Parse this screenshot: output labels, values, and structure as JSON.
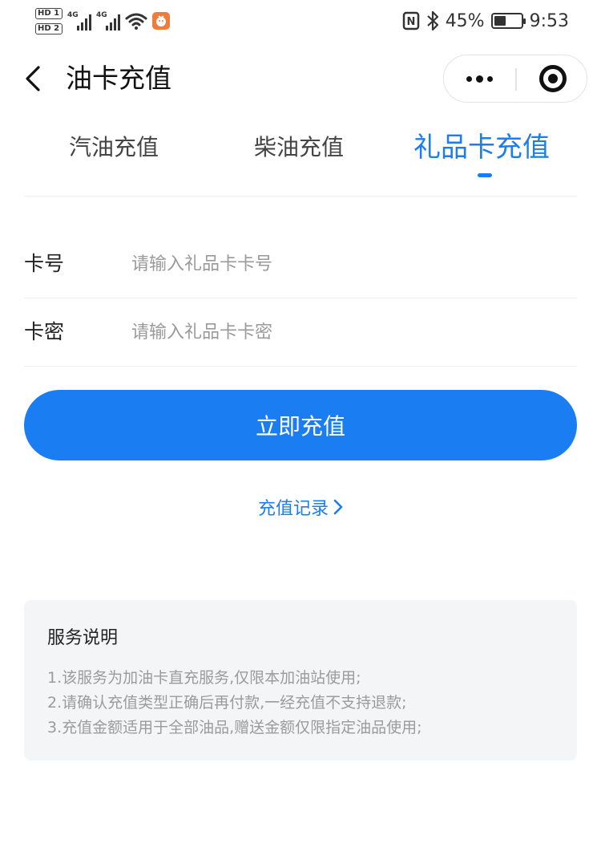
{
  "status_bar": {
    "hd1": "HD 1",
    "hd2": "HD 2",
    "net1": "4G",
    "net2": "4G",
    "battery_text": "45%",
    "battery_level": 0.45,
    "time": "9:53",
    "nfc_label": "N"
  },
  "navbar": {
    "title": "油卡充值",
    "back_icon": "chevron-left-icon",
    "more_icon": "more-dots-icon",
    "close_icon": "target-close-icon"
  },
  "tabs": [
    {
      "label": "汽油充值",
      "active": false
    },
    {
      "label": "柴油充值",
      "active": false
    },
    {
      "label": "礼品卡充值",
      "active": true
    }
  ],
  "form": {
    "card_number": {
      "label": "卡号",
      "placeholder": "请输入礼品卡卡号",
      "value": ""
    },
    "card_password": {
      "label": "卡密",
      "placeholder": "请输入礼品卡卡密",
      "value": ""
    }
  },
  "submit_label": "立即充值",
  "records_link": "充值记录",
  "notice": {
    "title": "服务说明",
    "lines": [
      "1.该服务为加油卡直充服务,仅限本加油站使用;",
      "2.请确认充值类型正确后再付款,一经充值不支持退款;",
      "3.充值金额适用于全部油品,赠送金额仅限指定油品使用;"
    ]
  },
  "colors": {
    "accent": "#1a7ef2",
    "notice_bg": "#f4f5f7",
    "placeholder": "#9a9a9a",
    "app_badge": "#f07b3a"
  }
}
